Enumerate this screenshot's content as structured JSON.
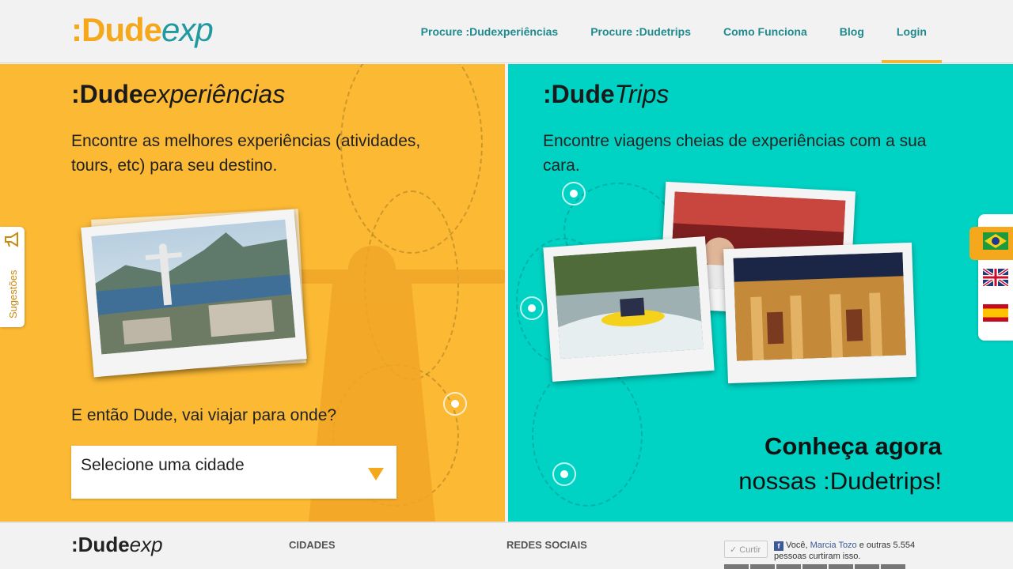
{
  "header": {
    "logo": {
      "colon": ":",
      "dude": "Dude",
      "exp": "exp"
    },
    "nav": [
      {
        "label": "Procure :Dudexperiências"
      },
      {
        "label": "Procure :Dudetrips"
      },
      {
        "label": "Como Funciona"
      },
      {
        "label": "Blog"
      },
      {
        "label": "Login"
      }
    ]
  },
  "left_panel": {
    "title_bold": ":Dude",
    "title_italic": "experiências",
    "description": "Encontre as melhores experiências (atividades, tours, etc) para seu destino.",
    "question": "E então Dude, vai viajar para onde?",
    "select": {
      "value": "Selecione uma cidade"
    }
  },
  "right_panel": {
    "title_bold": ":Dude",
    "title_italic": "Trips",
    "description": "Encontre viagens cheias de experiências com a sua cara.",
    "cta_line1": "Conheça agora",
    "cta_line2": "nossas :Dudetrips!"
  },
  "side": {
    "suggestions": "Sugestões"
  },
  "footer": {
    "logo_bold": ":Dude",
    "logo_italic": "exp",
    "cidades": "CIDADES",
    "redes_sociais": "REDES SOCIAIS",
    "like_button": "✓ Curtir",
    "fb_prefix": "Você, ",
    "fb_name": "Marcia Tozo",
    "fb_suffix": " e outras 5.554 pessoas curtiram isso."
  },
  "colors": {
    "orange": "#fbb934",
    "teal": "#00d3c4",
    "brand_orange": "#f5a81c",
    "brand_teal": "#1f9aa0"
  }
}
